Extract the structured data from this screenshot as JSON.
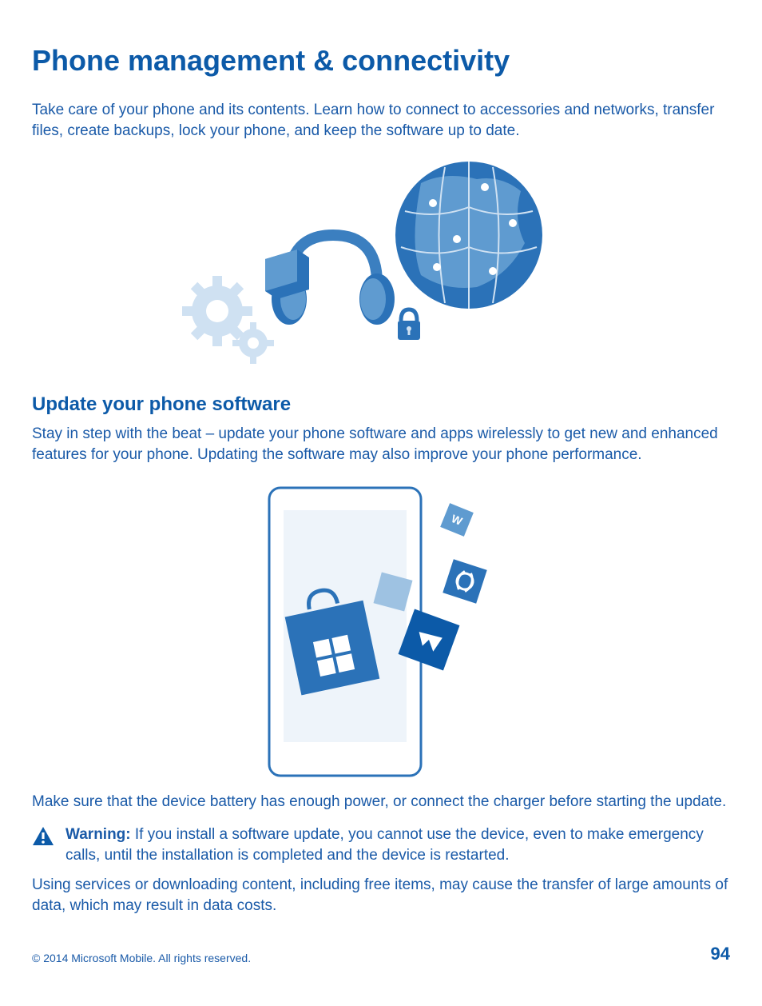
{
  "heading": "Phone management & connectivity",
  "intro": "Take care of your phone and its contents. Learn how to connect to accessories and networks, transfer files, create backups, lock your phone, and keep the software up to date.",
  "subheading": "Update your phone software",
  "sub_intro": "Stay in step with the beat – update your phone software and apps wirelessly to get new and enhanced features for your phone. Updating the software may also improve your phone performance.",
  "battery_note": "Make sure that the device battery has enough power, or connect the charger before starting the update.",
  "warning": {
    "label": "Warning:",
    "text": " If you install a software update, you cannot use the device, even to make emergency calls, until the installation is completed and the device is restarted."
  },
  "data_note": "Using services or downloading content, including free items, may cause the transfer of large amounts of data, which may result in data costs.",
  "footer": {
    "copyright": "© 2014 Microsoft Mobile. All rights reserved.",
    "page": "94"
  }
}
